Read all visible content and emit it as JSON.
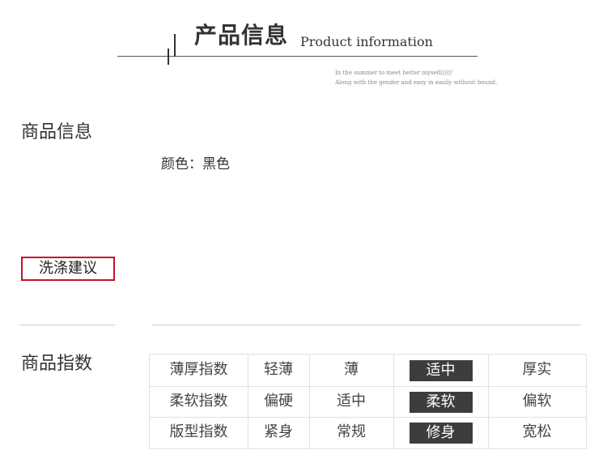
{
  "header": {
    "title_cn": "产品信息",
    "title_en": "Product information",
    "tagline_1": "In the summer to meet better myself//////",
    "tagline_2": "Along with the gender and easy in easily without bound."
  },
  "product_info": {
    "heading": "商品信息",
    "color_label": "颜色：",
    "color_value": "黑色"
  },
  "washing": {
    "heading": "洗涤建议"
  },
  "product_index": {
    "heading": "商品指数",
    "rows": [
      {
        "name": "薄厚指数",
        "options": [
          "轻薄",
          "薄",
          "适中",
          "厚实"
        ],
        "selected": "适中"
      },
      {
        "name": "柔软指数",
        "options": [
          "偏硬",
          "适中",
          "柔软",
          "偏软"
        ],
        "selected": "柔软"
      },
      {
        "name": "版型指数",
        "options": [
          "紧身",
          "常规",
          "修身",
          "宽松"
        ],
        "selected": "修身"
      }
    ]
  }
}
